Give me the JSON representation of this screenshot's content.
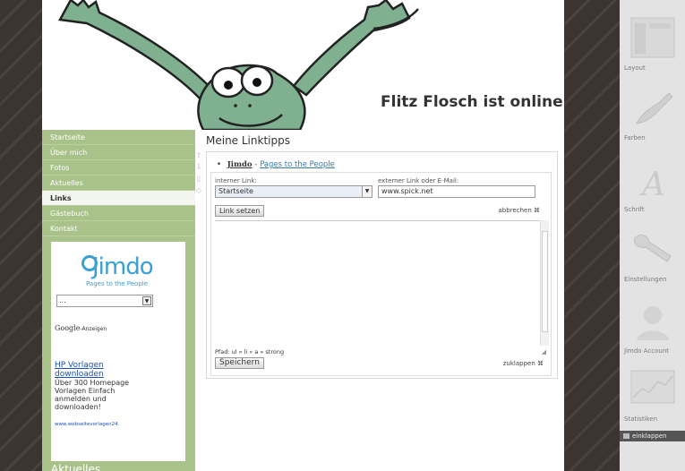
{
  "site": {
    "title": "Flitz Flosch ist online"
  },
  "nav": {
    "items": [
      {
        "label": "Startseite",
        "active": false
      },
      {
        "label": "Über mich",
        "active": false
      },
      {
        "label": "Fotos",
        "active": false
      },
      {
        "label": "Aktuelles",
        "active": false
      },
      {
        "label": "Links",
        "active": true
      },
      {
        "label": "Gästebuch",
        "active": false
      },
      {
        "label": "Kontakt",
        "active": false
      }
    ]
  },
  "ad": {
    "logo_text": "Jimdo",
    "logo_tagline": "Pages to the People",
    "select_value": "...",
    "google_label": "Google",
    "google_suffix": "-Anzeigen",
    "ad_title": "HP Vorlagen downloaden",
    "ad_body": "Über 300 Homepage Vorlagen Einfach anmelden und downloaden!",
    "ad_url": "www.webseitevorlagen24."
  },
  "sidebar": {
    "heading": "Aktuelles"
  },
  "main": {
    "heading": "Meine Linktipps",
    "link_item": {
      "link_text": "Jimdo",
      "separator": " - ",
      "description": "Pages to the People"
    },
    "editor": {
      "internal_label": "interner Link:",
      "internal_value": "Startseite",
      "external_label": "externer Link oder E-Mail:",
      "external_value": "www.spick.net",
      "link_button": "Link setzen",
      "cancel_label": "abbrechen",
      "path_label": "Pfad: ul » li » a » strong",
      "save_button": "Speichern",
      "collapse_label": "zuklappen"
    }
  },
  "admin": {
    "items": [
      {
        "label": "Layout",
        "icon": "layout-icon"
      },
      {
        "label": "Farben",
        "icon": "brush-icon"
      },
      {
        "label": "Schrift",
        "icon": "font-icon"
      },
      {
        "label": "Einstellungen",
        "icon": "wrench-icon"
      },
      {
        "label": "Jimdo Account",
        "icon": "user-icon"
      },
      {
        "label": "Statistiken",
        "icon": "chart-icon"
      }
    ],
    "collapse_label": "einklappen"
  },
  "colors": {
    "sidebar_green": "#a9c28a",
    "frog_green": "#7fb08f",
    "jimdo_blue": "#3a9fd3",
    "background_dark": "#3a3330"
  }
}
